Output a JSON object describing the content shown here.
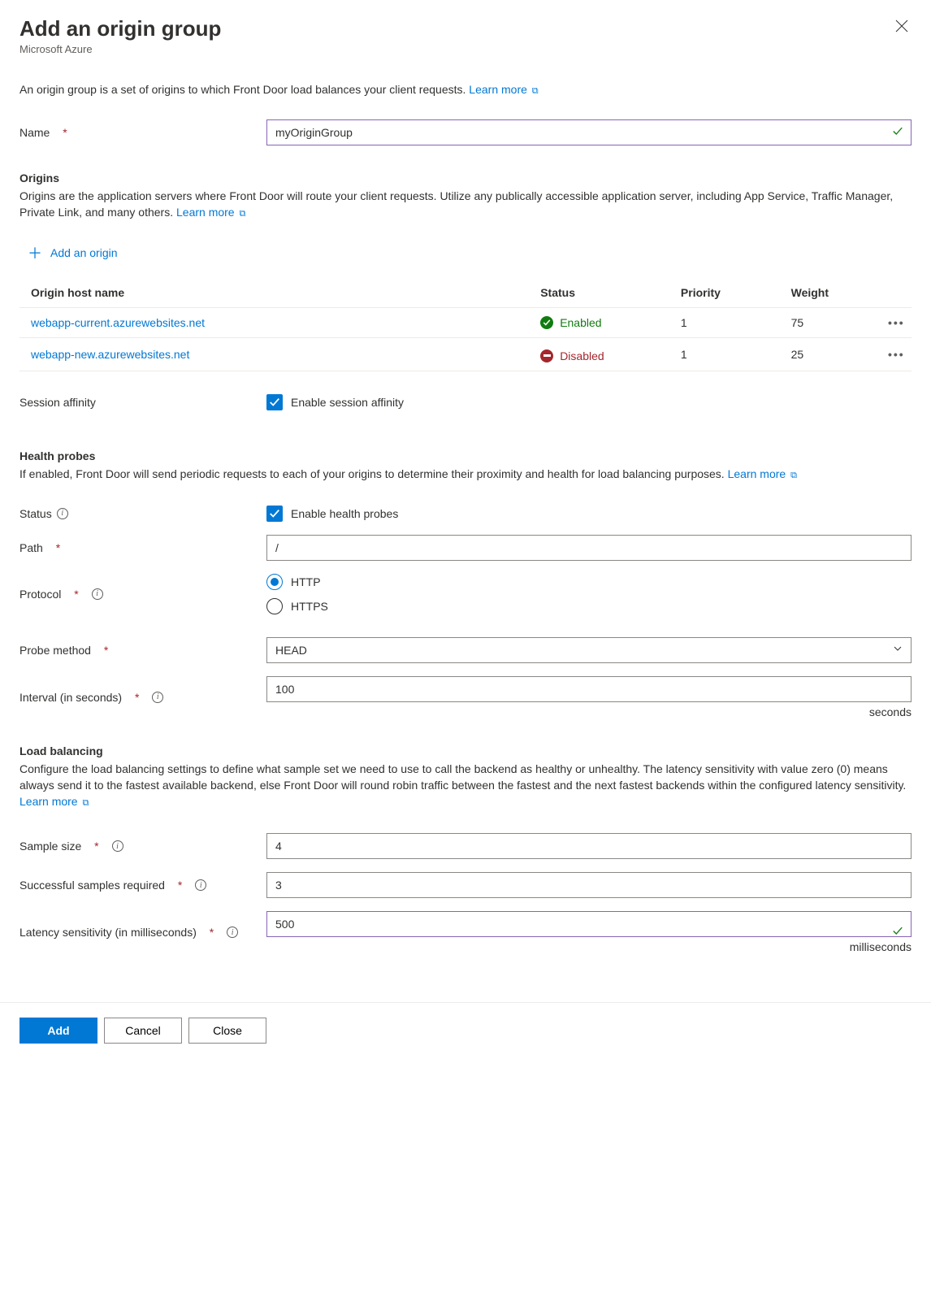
{
  "header": {
    "title": "Add an origin group",
    "subtitle": "Microsoft Azure"
  },
  "description": "An origin group is a set of origins to which Front Door load balances your client requests.",
  "learn_more": "Learn more",
  "name": {
    "label": "Name",
    "value": "myOriginGroup"
  },
  "origins": {
    "heading": "Origins",
    "description": "Origins are the application servers where Front Door will route your client requests. Utilize any publically accessible application server, including App Service, Traffic Manager, Private Link, and many others.",
    "add_label": "Add an origin",
    "columns": {
      "host": "Origin host name",
      "status": "Status",
      "priority": "Priority",
      "weight": "Weight"
    },
    "rows": [
      {
        "host": "webapp-current.azurewebsites.net",
        "status": "Enabled",
        "priority": "1",
        "weight": "75"
      },
      {
        "host": "webapp-new.azurewebsites.net",
        "status": "Disabled",
        "priority": "1",
        "weight": "25"
      }
    ]
  },
  "session_affinity": {
    "label": "Session affinity",
    "checkbox_label": "Enable session affinity"
  },
  "health_probes": {
    "heading": "Health probes",
    "description": "If enabled, Front Door will send periodic requests to each of your origins to determine their proximity and health for load balancing purposes.",
    "status_label": "Status",
    "status_checkbox": "Enable health probes",
    "path_label": "Path",
    "path_value": "/",
    "protocol_label": "Protocol",
    "protocol_http": "HTTP",
    "protocol_https": "HTTPS",
    "method_label": "Probe method",
    "method_value": "HEAD",
    "interval_label": "Interval (in seconds)",
    "interval_value": "100",
    "interval_unit": "seconds"
  },
  "load_balancing": {
    "heading": "Load balancing",
    "description": "Configure the load balancing settings to define what sample set we need to use to call the backend as healthy or unhealthy. The latency sensitivity with value zero (0) means always send it to the fastest available backend, else Front Door will round robin traffic between the fastest and the next fastest backends within the configured latency sensitivity.",
    "sample_label": "Sample size",
    "sample_value": "4",
    "success_label": "Successful samples required",
    "success_value": "3",
    "latency_label": "Latency sensitivity (in milliseconds)",
    "latency_value": "500",
    "latency_unit": "milliseconds"
  },
  "footer": {
    "add": "Add",
    "cancel": "Cancel",
    "close": "Close"
  }
}
